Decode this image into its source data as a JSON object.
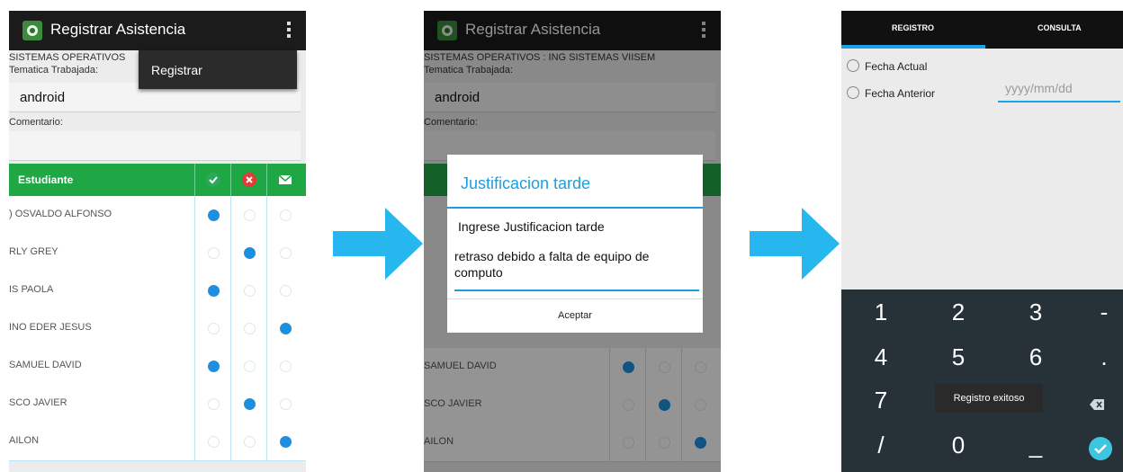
{
  "screen1": {
    "app_title": "Registrar Asistencia",
    "subject": "SISTEMAS OPERATIVOS",
    "topic_label": "Tematica Trabajada:",
    "topic_value": "android",
    "comment_label": "Comentario:",
    "table_header": "Estudiante",
    "header_icons": [
      "check-icon",
      "cancel-icon",
      "mail-icon"
    ],
    "students": [
      {
        "name": ") OSVALDO ALFONSO",
        "selected": 0
      },
      {
        "name": "RLY GREY",
        "selected": 1
      },
      {
        "name": "IS PAOLA",
        "selected": 0
      },
      {
        "name": "INO EDER JESUS",
        "selected": 2
      },
      {
        "name": "SAMUEL DAVID",
        "selected": 0
      },
      {
        "name": "SCO JAVIER",
        "selected": 1
      },
      {
        "name": "AILON",
        "selected": 2
      }
    ],
    "menu_item": "Registrar"
  },
  "screen2": {
    "app_title": "Registrar Asistencia",
    "subject": "SISTEMAS OPERATIVOS : ING SISTEMAS VIISEM",
    "topic_label": "Tematica Trabajada:",
    "topic_value": "android",
    "comment_label": "Comentario:",
    "rows_visible": [
      {
        "name": "SAMUEL DAVID",
        "selected": 0
      },
      {
        "name": "SCO JAVIER",
        "selected": 1
      },
      {
        "name": "AILON",
        "selected": 2
      }
    ],
    "dialog": {
      "title": "Justificacion tarde",
      "message": "Ingrese Justificacion tarde",
      "input_value": "retraso debido a falta de equipo de computo",
      "button": "Aceptar"
    }
  },
  "screen3": {
    "tabs": [
      "REGISTRO",
      "CONSULTA"
    ],
    "option_current": "Fecha Actual",
    "option_previous": "Fecha Anterior",
    "date_placeholder": "yyyy/mm/dd",
    "keypad": {
      "row1": [
        "1",
        "2",
        "3",
        "-"
      ],
      "row2": [
        "4",
        "5",
        "6",
        "."
      ],
      "row3": [
        "7",
        ""
      ],
      "row4": [
        "/",
        "0",
        "_"
      ]
    },
    "toast": "Registro exitoso"
  },
  "colors": {
    "accent_blue": "#1a9ee0",
    "header_green": "#1fa645",
    "arrow": "#27b7ef",
    "keypad_bg": "#263238"
  }
}
